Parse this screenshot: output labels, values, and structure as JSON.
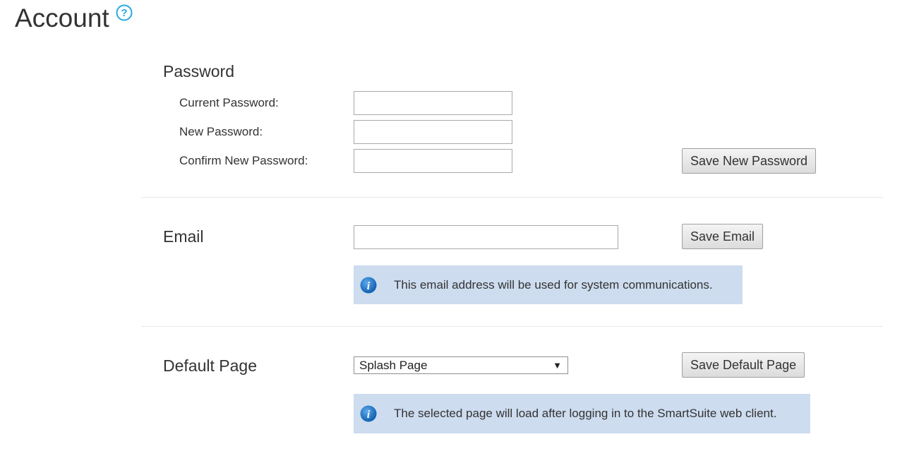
{
  "header": {
    "title": "Account",
    "help_icon": "question-circle-icon",
    "accent": "#29a8e0"
  },
  "password": {
    "section_title": "Password",
    "current_label": "Current Password:",
    "new_label": "New Password:",
    "confirm_label": "Confirm New Password:",
    "current_value": "",
    "new_value": "",
    "confirm_value": "",
    "save_label": "Save New Password"
  },
  "email": {
    "section_title": "Email",
    "value": "",
    "save_label": "Save Email",
    "info_icon": "info-icon",
    "info_text": "This email address will be used for system communications."
  },
  "default_page": {
    "section_title": "Default Page",
    "selected": "Splash Page",
    "save_label": "Save Default Page",
    "info_icon": "info-icon",
    "info_text": "The selected page will load after logging in to the SmartSuite web client."
  },
  "colors": {
    "info_background": "#cddcef",
    "info_icon": "#1a72c4"
  }
}
